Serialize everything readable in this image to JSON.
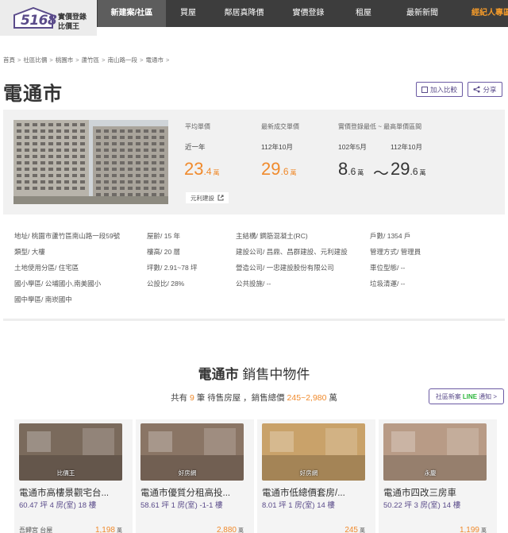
{
  "logo": {
    "number": "5168",
    "line1": "實價登錄",
    "line2": "比價王"
  },
  "nav": [
    {
      "label": "新建案/社區",
      "width": 86,
      "active": true
    },
    {
      "label": "買屋",
      "width": 56
    },
    {
      "label": "鄰居真降價",
      "width": 85
    },
    {
      "label": "實價登錄",
      "width": 77
    },
    {
      "label": "租屋",
      "width": 62
    },
    {
      "label": "最新新聞",
      "width": 86
    },
    {
      "label": "經紀人專區",
      "width": 88,
      "agent": true
    }
  ],
  "breadcrumb": [
    "首頁",
    "社區比價",
    "桃園市",
    "蘆竹區",
    "南山路一段",
    "電通市"
  ],
  "page": {
    "title": "電通市"
  },
  "actions": {
    "compare": "加入比較",
    "share": "分享"
  },
  "price": {
    "avg_label": "平均單價",
    "avg_period": "近一年",
    "avg_int": "23",
    "avg_dec": ".4",
    "unit": "萬",
    "latest_label": "最新成交單價",
    "latest_month": "112年10月",
    "latest_int": "29",
    "latest_dec": ".6",
    "range_label": "實價登錄最低 ~ 最高單價區間",
    "range_from_month": "102年5月",
    "range_to_month": "112年10月",
    "range_low_int": "8",
    "range_low_dec": ".6",
    "range_high_int": "29",
    "range_high_dec": ".6",
    "tilde": "～",
    "builder_tag": "元利建設"
  },
  "info": {
    "address": "地址/ 桃園市蘆竹區南山路一段59號",
    "type": "類型/ 大樓",
    "zoning": "土地使用分區/ 住宅區",
    "elementary": "國小學區/ 公埔國小,南美國小",
    "junior": "國中學區/ 南崁國中",
    "age": "屋齡/ 15 年",
    "floors": "樓高/ 20 層",
    "area": "坪數/ 2.91~78 坪",
    "public_ratio": "公設比/ 28%",
    "structure": "主結構/ 鋼筋混凝土(RC)",
    "builder": "建設公司/ 昌鼎、昌群建設、元利建設",
    "constructor": "營造公司/ 一忠建設股份有限公司",
    "facilities": "公共設施/ --",
    "households": "戶數/ 1354 戶",
    "management": "管理方式/ 管理員",
    "parking": "車位型態/ --",
    "garbage": "垃圾清運/ --"
  },
  "listings_section": {
    "title_name": "電通市",
    "title_rest": "銷售中物件",
    "sub_pre": "共有",
    "sub_count": "9",
    "sub_mid": "筆 待售房屋 ，銷售總價",
    "sub_range": "245~2,980",
    "sub_unit": "萬",
    "notify_pre": "社區新案",
    "notify_line": "LINE",
    "notify_post": "通知 >"
  },
  "listings": [
    {
      "source": "比價王",
      "title": "電通市高樓景觀宅台...",
      "area": "60.47",
      "rooms": "4 房(室)",
      "floor": "18 樓",
      "agent": "吾歸宮 台屋",
      "price": "1,198",
      "price_unit": "萬",
      "img": "#7a6a5c"
    },
    {
      "source": "好房網",
      "title": "電通市優質分租高投...",
      "area": "58.61",
      "rooms": "1 房(室)",
      "floor": "-1-1 樓",
      "agent": "",
      "price": "2,880",
      "price_unit": "萬",
      "img": "#8a7565"
    },
    {
      "source": "好房網",
      "title": "電通市低總價套房/...",
      "area": "8.01",
      "rooms": "1 房(室)",
      "floor": "14 樓",
      "agent": "",
      "price": "245",
      "price_unit": "萬",
      "img": "#c9a26a"
    },
    {
      "source": "永慶",
      "title": "電通市四改三房車",
      "area": "50.22",
      "rooms": "3 房(室)",
      "floor": "14 樓",
      "agent": "",
      "price": "1,199",
      "price_unit": "萬",
      "img": "#b89b86"
    }
  ],
  "labels": {
    "ping": "坪"
  }
}
